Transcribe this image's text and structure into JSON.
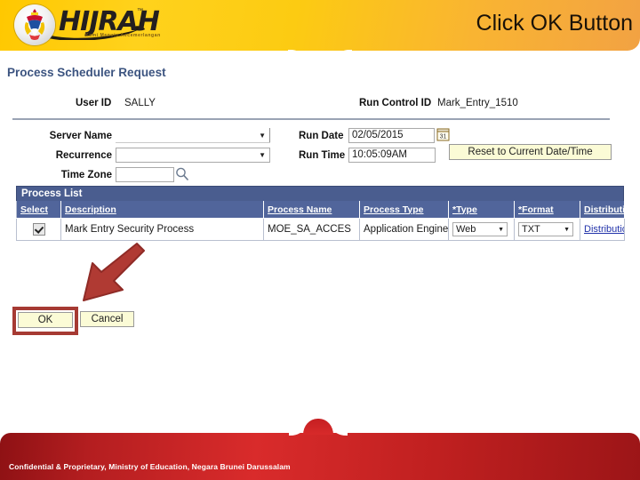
{
  "header": {
    "logo_text": "HIJRAH",
    "logo_tm": "™",
    "logo_sub": "Kami Menuju Kecemerlangan",
    "banner_text": "Click OK Button",
    "logo_icon": "brunei-crest-circle-icon"
  },
  "page": {
    "title": "Process Scheduler Request",
    "user_id_label": "User ID",
    "user_id_value": "SALLY",
    "run_control_label": "Run Control ID",
    "run_control_value": "Mark_Entry_1510"
  },
  "form": {
    "server_name_label": "Server Name",
    "server_name_value": "",
    "recurrence_label": "Recurrence",
    "recurrence_value": "",
    "time_zone_label": "Time Zone",
    "time_zone_value": "",
    "lookup_icon": "magnifier-icon",
    "run_date_label": "Run Date",
    "run_date_value": "02/05/2015",
    "calendar_icon": "calendar-icon",
    "calendar_day": "31",
    "run_time_label": "Run Time",
    "run_time_value": "10:05:09AM",
    "reset_button": "Reset to Current Date/Time",
    "caret_icon": "chevron-down-icon"
  },
  "process_list": {
    "title": "Process List",
    "columns": [
      "Select",
      "Description",
      "Process Name",
      "Process Type",
      "*Type",
      "*Format",
      "Distribution"
    ],
    "rows": [
      {
        "selected": true,
        "description": "Mark Entry Security Process",
        "process_name": "MOE_SA_ACCES",
        "process_type": "Application Engine",
        "type": "Web",
        "format": "TXT",
        "distribution": "Distribution"
      }
    ]
  },
  "actions": {
    "ok_label": "OK",
    "cancel_label": "Cancel",
    "highlight_color": "#A63A33",
    "arrow_icon": "red-arrow-pointing-down-left"
  },
  "footer": {
    "text": "Confidential & Proprietary, Ministry of Education, Negara Brunei Darussalam"
  }
}
